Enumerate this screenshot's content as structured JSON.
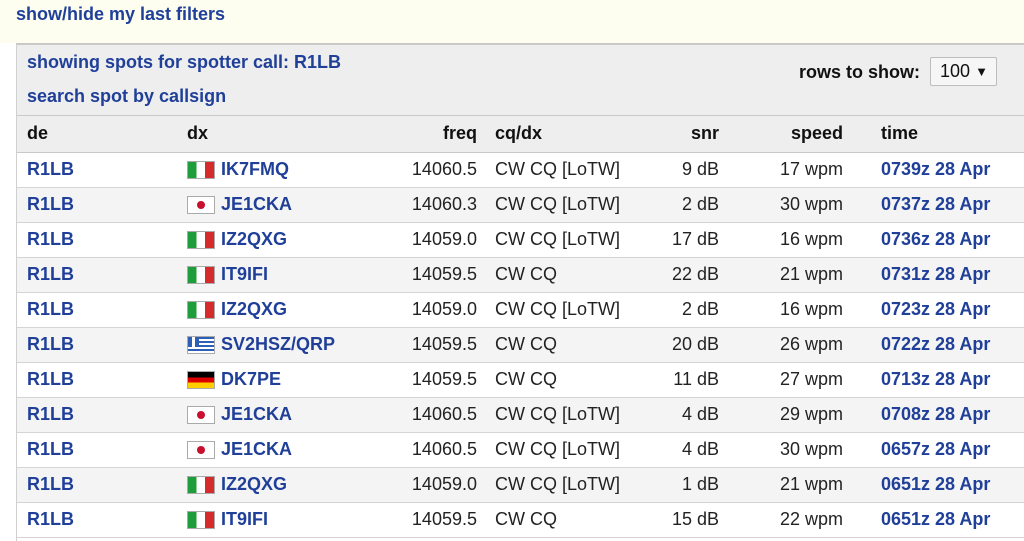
{
  "filters": {
    "toggle_label": "show/hide my last filters"
  },
  "header": {
    "spotter_label": "showing spots for spotter call: R1LB",
    "search_label": "search spot by callsign",
    "rows_label": "rows to show:",
    "rows_value": "100",
    "rows_caret": "▼"
  },
  "columns": {
    "de": "de",
    "dx": "dx",
    "freq": "freq",
    "mode": "cq/dx",
    "snr": "snr",
    "speed": "speed",
    "time": "time"
  },
  "rows": [
    {
      "de": "R1LB",
      "flag": "it",
      "dx": "IK7FMQ",
      "freq": "14060.5",
      "mode": "CW CQ [LoTW]",
      "snr": "9 dB",
      "speed": "17 wpm",
      "time": "0739z 28 Apr"
    },
    {
      "de": "R1LB",
      "flag": "jp",
      "dx": "JE1CKA",
      "freq": "14060.3",
      "mode": "CW CQ [LoTW]",
      "snr": "2 dB",
      "speed": "30 wpm",
      "time": "0737z 28 Apr"
    },
    {
      "de": "R1LB",
      "flag": "it",
      "dx": "IZ2QXG",
      "freq": "14059.0",
      "mode": "CW CQ [LoTW]",
      "snr": "17 dB",
      "speed": "16 wpm",
      "time": "0736z 28 Apr"
    },
    {
      "de": "R1LB",
      "flag": "it",
      "dx": "IT9IFI",
      "freq": "14059.5",
      "mode": "CW CQ",
      "snr": "22 dB",
      "speed": "21 wpm",
      "time": "0731z 28 Apr"
    },
    {
      "de": "R1LB",
      "flag": "it",
      "dx": "IZ2QXG",
      "freq": "14059.0",
      "mode": "CW CQ [LoTW]",
      "snr": "2 dB",
      "speed": "16 wpm",
      "time": "0723z 28 Apr"
    },
    {
      "de": "R1LB",
      "flag": "gr",
      "dx": "SV2HSZ/QRP",
      "freq": "14059.5",
      "mode": "CW CQ",
      "snr": "20 dB",
      "speed": "26 wpm",
      "time": "0722z 28 Apr"
    },
    {
      "de": "R1LB",
      "flag": "de",
      "dx": "DK7PE",
      "freq": "14059.5",
      "mode": "CW CQ",
      "snr": "11 dB",
      "speed": "27 wpm",
      "time": "0713z 28 Apr"
    },
    {
      "de": "R1LB",
      "flag": "jp",
      "dx": "JE1CKA",
      "freq": "14060.5",
      "mode": "CW CQ [LoTW]",
      "snr": "4 dB",
      "speed": "29 wpm",
      "time": "0708z 28 Apr"
    },
    {
      "de": "R1LB",
      "flag": "jp",
      "dx": "JE1CKA",
      "freq": "14060.5",
      "mode": "CW CQ [LoTW]",
      "snr": "4 dB",
      "speed": "30 wpm",
      "time": "0657z 28 Apr"
    },
    {
      "de": "R1LB",
      "flag": "it",
      "dx": "IZ2QXG",
      "freq": "14059.0",
      "mode": "CW CQ [LoTW]",
      "snr": "1 dB",
      "speed": "21 wpm",
      "time": "0651z 28 Apr"
    },
    {
      "de": "R1LB",
      "flag": "it",
      "dx": "IT9IFI",
      "freq": "14059.5",
      "mode": "CW CQ",
      "snr": "15 dB",
      "speed": "22 wpm",
      "time": "0651z 28 Apr"
    }
  ],
  "colors": {
    "link": "#1f3f99",
    "header_bg": "#eeeeee",
    "strip_bg": "#fdfdf0"
  }
}
